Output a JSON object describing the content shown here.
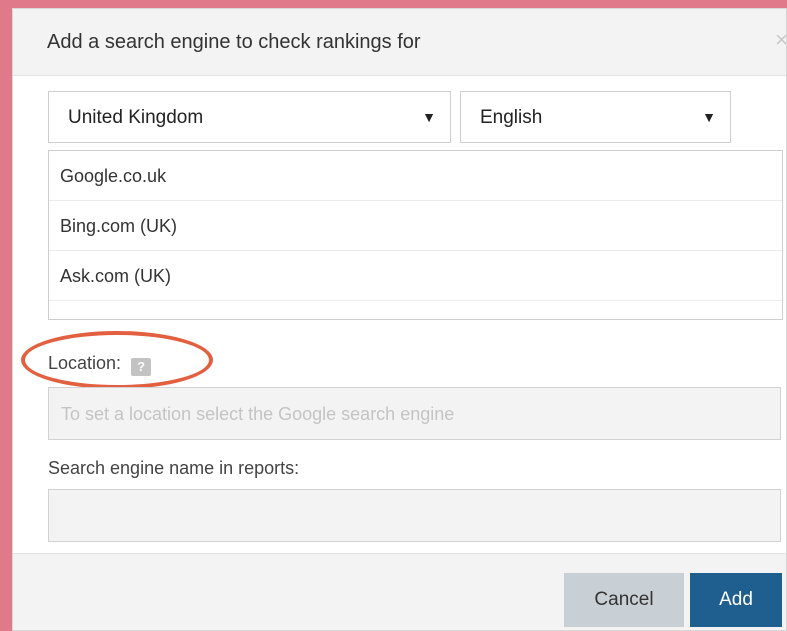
{
  "dialog": {
    "title": "Add a search engine to check rankings for",
    "close_icon": "×"
  },
  "country_select": {
    "value": "United Kingdom",
    "caret": "▼"
  },
  "language_select": {
    "value": "English",
    "caret": "▼"
  },
  "engines": [
    "Google.co.uk",
    "Bing.com (UK)",
    "Ask.com (UK)"
  ],
  "location": {
    "label": "Location:",
    "help_icon": "?",
    "placeholder": "To set a location select the Google search engine"
  },
  "report_name": {
    "label": "Search engine name in reports:",
    "value": ""
  },
  "footer": {
    "cancel_label": "Cancel",
    "add_label": "Add"
  },
  "colors": {
    "backdrop": "#e07a8a",
    "highlight": "#e2603f",
    "primary_button": "#1f5f8f"
  }
}
